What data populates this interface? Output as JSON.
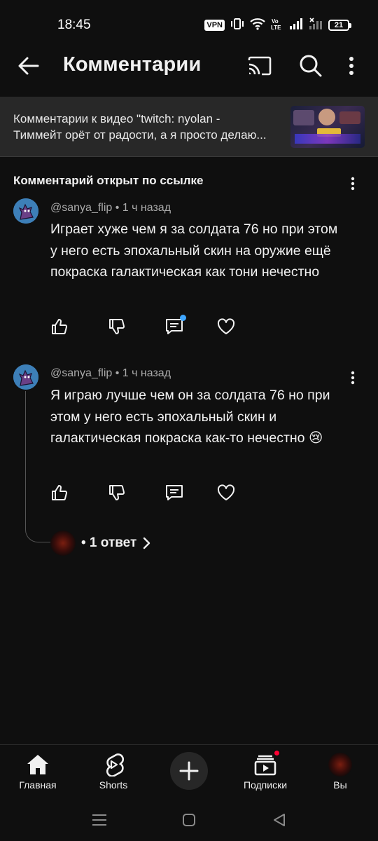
{
  "status_bar": {
    "time": "18:45",
    "vpn_label": "VPN",
    "battery_level": "21",
    "icons": [
      "vpn-icon",
      "vibrate-icon",
      "wifi-icon",
      "volte-icon",
      "signal-icon",
      "signal-x-icon",
      "battery-icon"
    ]
  },
  "header": {
    "title": "Комментарии",
    "icons": [
      "back-arrow-icon",
      "cast-icon",
      "search-icon",
      "more-vertical-icon"
    ]
  },
  "video_bar": {
    "line1": "Комментарии к видео \"twitch: nyolan -",
    "line2": "Тиммейт орёт от радости, а я просто делаю..."
  },
  "section": {
    "heading": "Комментарий открыт по ссылке"
  },
  "comments": [
    {
      "author": "@sanya_flip",
      "time": "1 ч назад",
      "meta": "@sanya_flip • 1 ч назад",
      "text": "Играет хуже чем я за солдата 76 но при этом у него есть эпохальный скин на оружие ещё покраска галактическая как тони нечестно",
      "reply_notification": true
    },
    {
      "author": "@sanya_flip",
      "time": "1 ч назад",
      "meta": "@sanya_flip • 1 ч назад",
      "text": "Я играю лучше чем он за солдата 76 но при этом у него есть эпохальный скин и галактическая покраска как-то нечестно 😢",
      "replies_label": "• 1 ответ"
    }
  ],
  "bottom_nav": {
    "items": [
      {
        "label": "Главная",
        "icon": "home-icon"
      },
      {
        "label": "Shorts",
        "icon": "shorts-icon"
      },
      {
        "label": "",
        "icon": "create-plus-icon"
      },
      {
        "label": "Подписки",
        "icon": "subscriptions-icon"
      },
      {
        "label": "Вы",
        "icon": "account-avatar"
      }
    ]
  },
  "colors": {
    "background": "#0f0f0f",
    "video_bar": "#282828",
    "accent_blue": "#3ea6ff",
    "notification_red": "#ff0033"
  }
}
